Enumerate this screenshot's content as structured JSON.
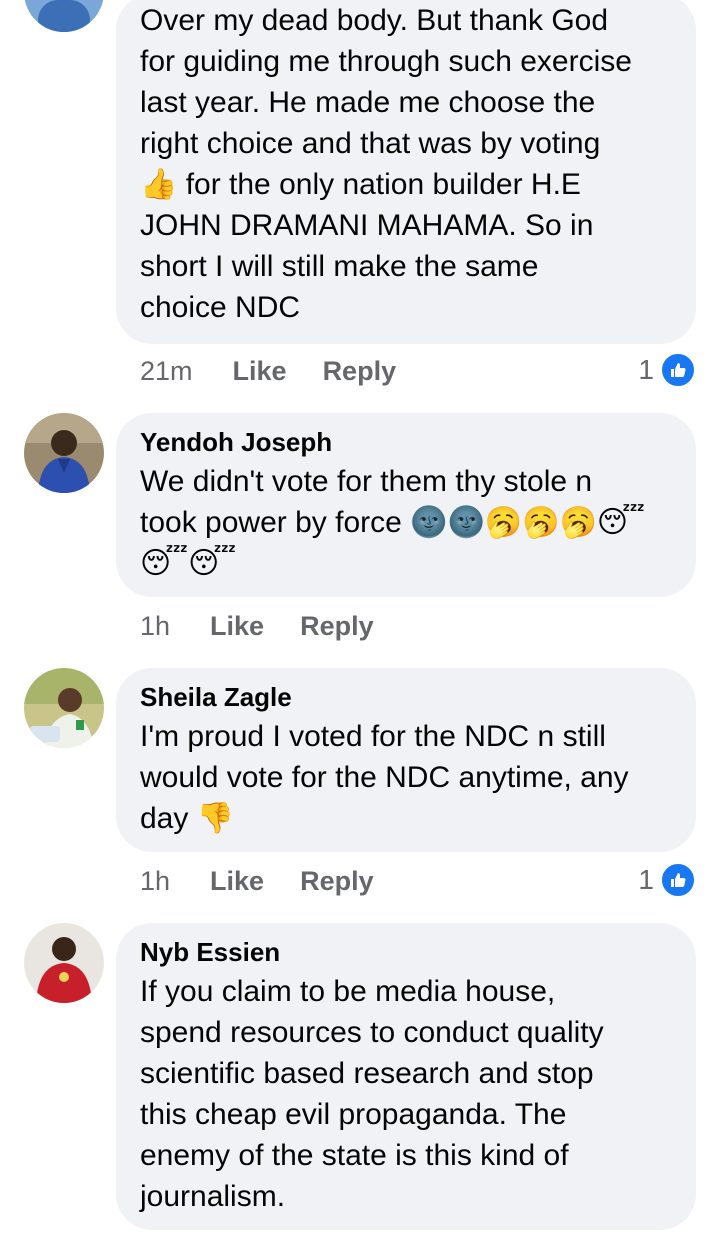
{
  "comments": [
    {
      "author": "",
      "text": "Over my dead body. But thank God\nfor guiding me through such exercise\nlast year. He made me choose the\nright choice and that was by voting\n👍 for the only nation builder H.E\nJOHN DRAMANI MAHAMA. So in\nshort I will still make the same\nchoice NDC",
      "time": "21m",
      "like_label": "Like",
      "reply_label": "Reply",
      "reaction_count": "1",
      "reaction_icon": "like-icon"
    },
    {
      "author": "Yendoh Joseph",
      "text": "We didn't vote for them thy stole n\ntook power by force 🌚🌚🥱🥱🥱😴\n😴😴",
      "time": "1h",
      "like_label": "Like",
      "reply_label": "Reply",
      "reaction_count": "",
      "reaction_icon": ""
    },
    {
      "author": "Sheila Zagle",
      "text": "I'm proud I voted for the NDC  n still\nwould vote for the NDC anytime, any\nday 👎",
      "time": "1h",
      "like_label": "Like",
      "reply_label": "Reply",
      "reaction_count": "1",
      "reaction_icon": "like-icon"
    },
    {
      "author": "Nyb Essien",
      "text": "If you claim to be media house,\nspend resources to conduct quality\nscientific based research and stop\nthis cheap evil propaganda. The\nenemy of the state is this kind of\njournalism.",
      "time": "",
      "like_label": "",
      "reply_label": "",
      "reaction_count": "",
      "reaction_icon": ""
    }
  ],
  "colors": {
    "bubble_bg": "#f0f2f5",
    "meta_text": "#65676b",
    "like_blue": "#1877f2"
  }
}
